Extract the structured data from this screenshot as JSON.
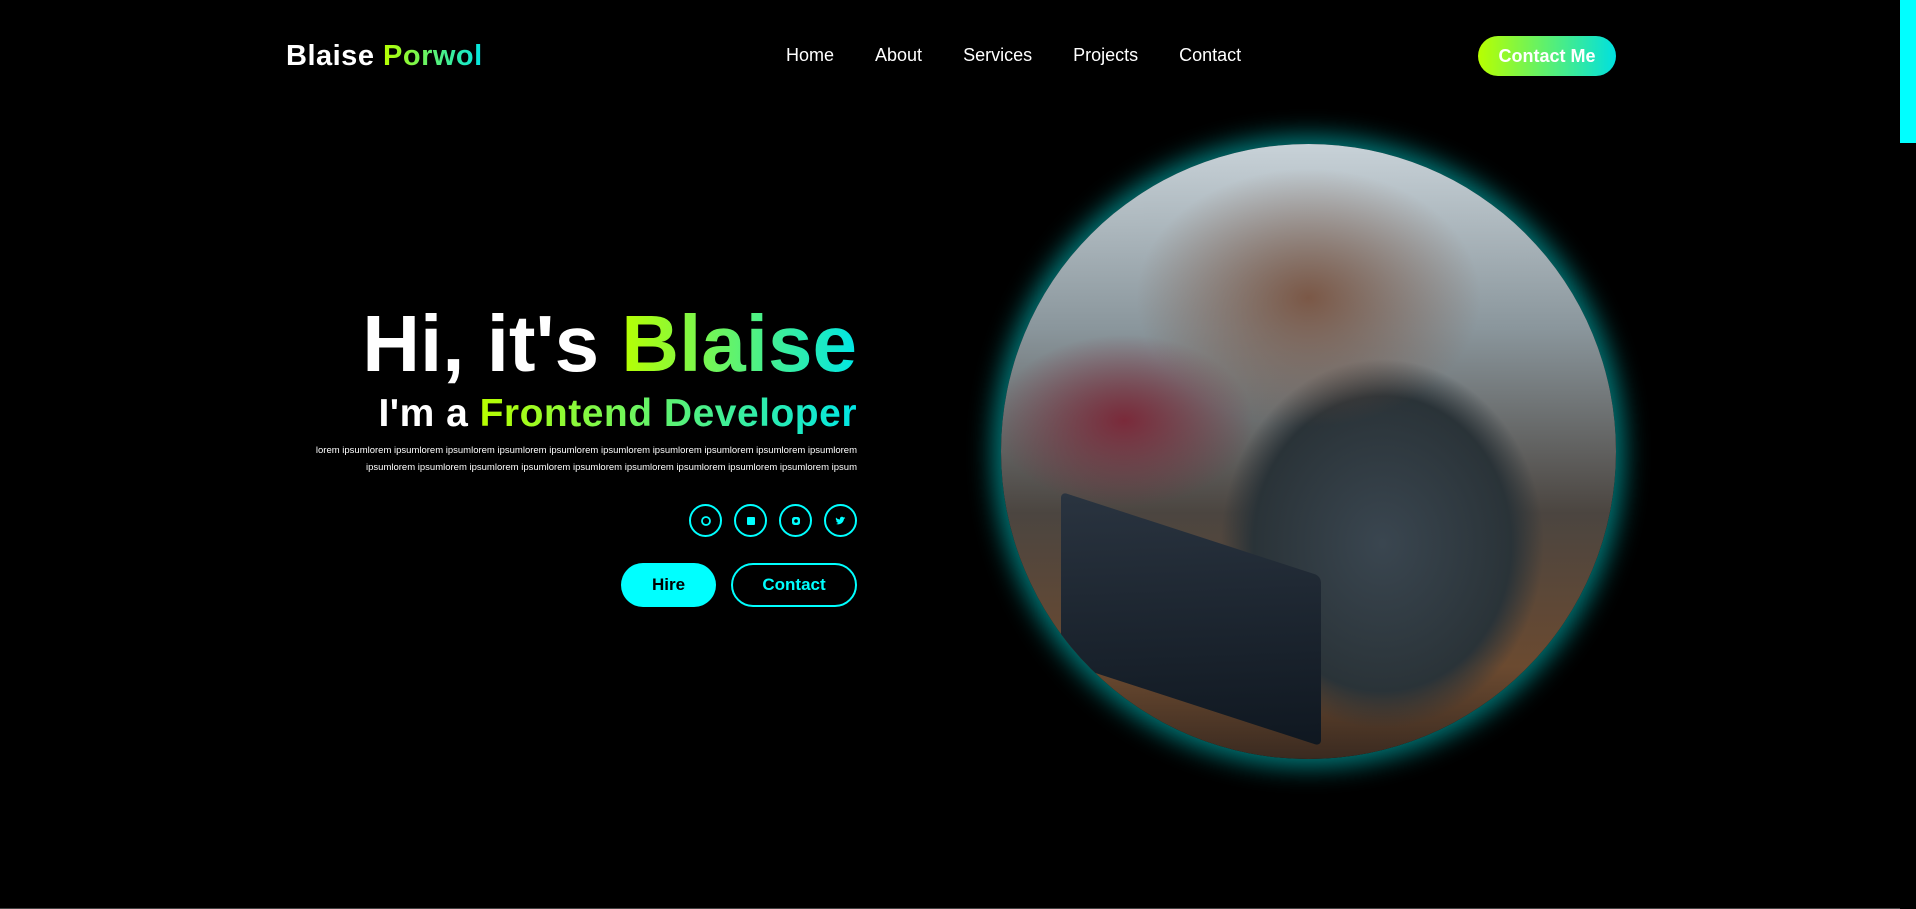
{
  "header": {
    "logo_first": "Blaise",
    "logo_last": "Porwol",
    "nav": [
      "Home",
      "About",
      "Services",
      "Projects",
      "Contact"
    ],
    "cta": "Contact Me"
  },
  "hero": {
    "greeting": "Hi, it's ",
    "name": "Blaise",
    "role_prefix": "I'm a ",
    "role": "Frontend Developer",
    "description": "lorem ipsumlorem ipsumlorem ipsumlorem ipsumlorem ipsumlorem ipsumlorem ipsumlorem ipsumlorem ipsumlorem ipsumlorem ipsumlorem ipsumlorem ipsumlorem ipsumlorem ipsumlorem ipsumlorem ipsumlorem ipsumlorem ipsumlorem ipsum",
    "socials": [
      "github",
      "linkedin",
      "instagram",
      "twitter"
    ],
    "hire": "Hire",
    "contact": "Contact"
  },
  "colors": {
    "accent": "#00ffff",
    "gradient_start": "#b8ff00",
    "gradient_end": "#00e6e6"
  }
}
